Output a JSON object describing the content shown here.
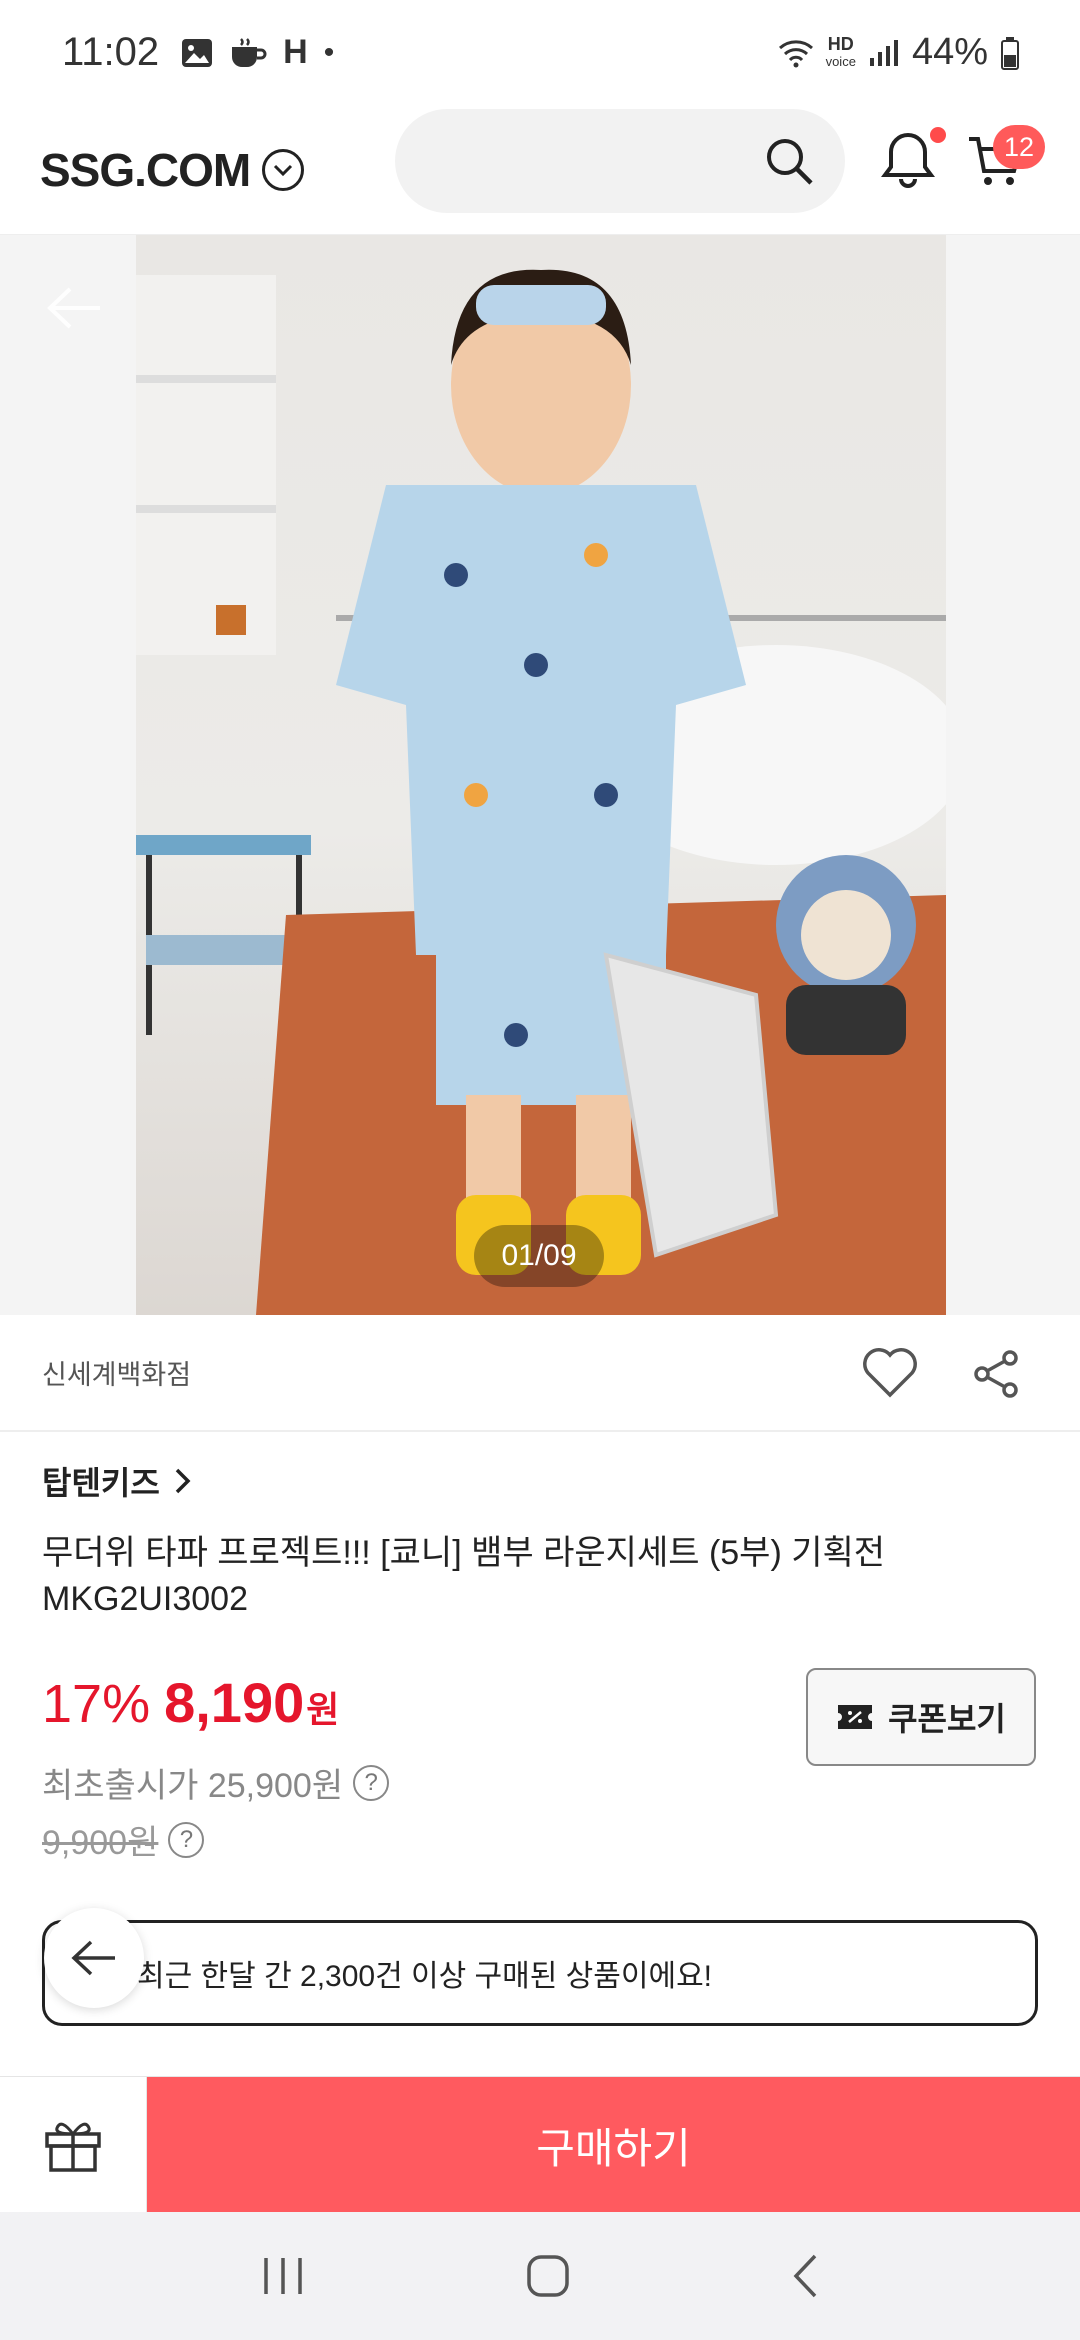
{
  "status": {
    "time": "11:02",
    "left_icons": [
      "gallery-icon",
      "coffee-icon",
      "h-icon",
      "dot-icon"
    ],
    "hd_label": "HD",
    "voice_label": "voice",
    "battery": "44%"
  },
  "header": {
    "logo": "SSG.COM",
    "cart_count": "12"
  },
  "gallery": {
    "counter": "01/09"
  },
  "store": {
    "name": "신세계백화점"
  },
  "product": {
    "brand": "탑텐키즈",
    "title": "무더위 타파 프로젝트!!! [쿄니] 뱀부 라운지세트 (5부) 기획전 MKG2UI3002",
    "discount": "17%",
    "price": "8,190",
    "currency": "원",
    "first_price": "최초출시가 25,900원",
    "original_price": "9,900원"
  },
  "coupon": {
    "label": "쿠폰보기"
  },
  "notice": {
    "text": "최근 한달 간 2,300건 이상 구매된 상품이에요!"
  },
  "bottom": {
    "buy_label": "구매하기"
  },
  "colors": {
    "accent": "#ff5a5f",
    "price": "#e5162c",
    "badge": "#ff5a5a"
  }
}
